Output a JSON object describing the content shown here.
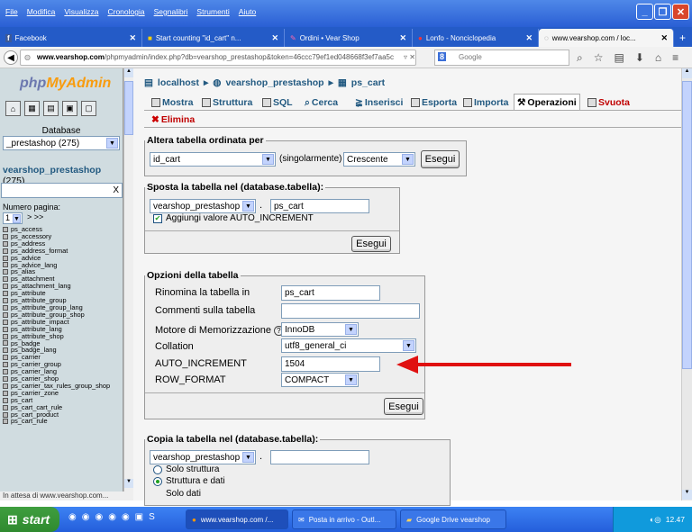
{
  "browser": {
    "menu": [
      "File",
      "Modifica",
      "Visualizza",
      "Cronologia",
      "Segnalibri",
      "Strumenti",
      "Aiuto"
    ],
    "tabs": [
      {
        "label": "Facebook"
      },
      {
        "label": "Start counting \"id_cart\" n..."
      },
      {
        "label": "Ordini • Vear Shop"
      },
      {
        "label": "Lonfo - Nonciclopedia"
      },
      {
        "label": "www.vearshop.com / loc..."
      }
    ],
    "url_domain": "www.vearshop.com",
    "url_rest": "/phpmyadmin/index.php?db=vearshop_prestashop&token=46ccc79ef1ed048668f3ef7aa5c",
    "search_placeholder": "Google",
    "new_tab": "+",
    "status": "In attesa di www.vearshop.com..."
  },
  "sidebar": {
    "logo_php": "php",
    "logo_mya": "MyAdmin",
    "database_label": "Database",
    "database_value": "_prestashop (275)",
    "db_link": "vearshop_prestashop",
    "db_count": "(275)",
    "filter_clear": "X",
    "page_label": "Numero pagina:",
    "page_value": "1",
    "page_nav": "> >>",
    "tables": [
      "ps_access",
      "ps_accessory",
      "ps_address",
      "ps_address_format",
      "ps_advice",
      "ps_advice_lang",
      "ps_alias",
      "ps_attachment",
      "ps_attachment_lang",
      "ps_attribute",
      "ps_attribute_group",
      "ps_attribute_group_lang",
      "ps_attribute_group_shop",
      "ps_attribute_impact",
      "ps_attribute_lang",
      "ps_attribute_shop",
      "ps_badge",
      "ps_badge_lang",
      "ps_carrier",
      "ps_carrier_group",
      "ps_carrier_lang",
      "ps_carrier_shop",
      "ps_carrier_tax_rules_group_shop",
      "ps_carrier_zone",
      "ps_cart",
      "ps_cart_cart_rule",
      "ps_cart_product",
      "ps_cart_rule"
    ]
  },
  "breadcrumb": {
    "server": "localhost",
    "database": "vearshop_prestashop",
    "table": "ps_cart",
    "sep": "▸"
  },
  "tabs": [
    "Mostra",
    "Struttura",
    "SQL",
    "Cerca",
    "Inserisci",
    "Esporta",
    "Importa",
    "Operazioni",
    "Svuota",
    "Elimina"
  ],
  "order": {
    "legend": "Altera tabella ordinata per",
    "column": "id_cart",
    "singly": "(singolarmente)",
    "direction": "Crescente",
    "submit": "Esegui"
  },
  "move": {
    "legend": "Sposta la tabella nel (database.tabella):",
    "db": "vearshop_prestashop",
    "dot": ".",
    "table": "ps_cart",
    "autoinc_label": "Aggiungi valore AUTO_INCREMENT",
    "autoinc_checked": true,
    "submit": "Esegui"
  },
  "options": {
    "legend": "Opzioni della tabella",
    "rename_label": "Rinomina la tabella in",
    "rename_value": "ps_cart",
    "comment_label": "Commenti sulla tabella",
    "comment_value": "",
    "engine_label": "Motore di Memorizzazione",
    "engine_value": "InnoDB",
    "collation_label": "Collation",
    "collation_value": "utf8_general_ci",
    "autoinc_label": "AUTO_INCREMENT",
    "autoinc_value": "1504",
    "rowformat_label": "ROW_FORMAT",
    "rowformat_value": "COMPACT",
    "submit": "Esegui"
  },
  "copy": {
    "legend": "Copia la tabella nel (database.tabella):",
    "db": "vearshop_prestashop",
    "dot": ".",
    "table": "",
    "opt_structure": "Solo struttura",
    "opt_structure_data": "Struttura e dati",
    "opt_data": "Solo dati"
  },
  "taskbar": {
    "start": "start",
    "items": [
      "www.vearshop.com /...",
      "Posta in arrivo - Outl...",
      "Google Drive vearshop"
    ],
    "clock": "12.47"
  },
  "colors": {
    "arrow": "#e01010",
    "accent": "#235a81",
    "drop_tab": "#c00000"
  }
}
